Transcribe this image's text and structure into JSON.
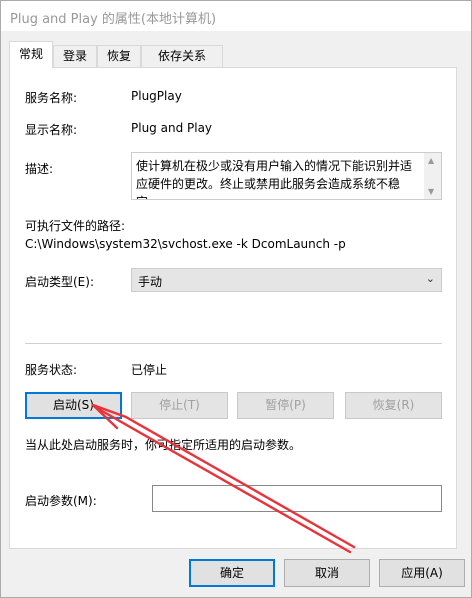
{
  "window": {
    "title": "Plug and Play 的属性(本地计算机)"
  },
  "tabs": [
    {
      "label": "常规",
      "active": true
    },
    {
      "label": "登录",
      "active": false
    },
    {
      "label": "恢复",
      "active": false
    },
    {
      "label": "依存关系",
      "active": false
    }
  ],
  "general": {
    "service_name_label": "服务名称:",
    "service_name_value": "PlugPlay",
    "display_name_label": "显示名称:",
    "display_name_value": "Plug and Play",
    "description_label": "描述:",
    "description_value": "使计算机在极少或没有用户输入的情况下能识别并适应硬件的更改。终止或禁用此服务会造成系统不稳定。",
    "exe_path_label": "可执行文件的路径:",
    "exe_path_value": "C:\\Windows\\system32\\svchost.exe -k DcomLaunch -p",
    "startup_type_label": "启动类型(E):",
    "startup_type_value": "手动",
    "status_label": "服务状态:",
    "status_value": "已停止",
    "start_button": "启动(S)",
    "stop_button": "停止(T)",
    "pause_button": "暂停(P)",
    "resume_button": "恢复(R)",
    "hint_text": "当从此处启动服务时，你可指定所适用的启动参数。",
    "start_params_label": "启动参数(M):",
    "start_params_value": ""
  },
  "footer": {
    "ok_button": "确定",
    "cancel_button": "取消",
    "apply_button": "应用(A)"
  },
  "colors": {
    "accent": "#0078d7",
    "annotation_arrow": "#e8333b"
  }
}
